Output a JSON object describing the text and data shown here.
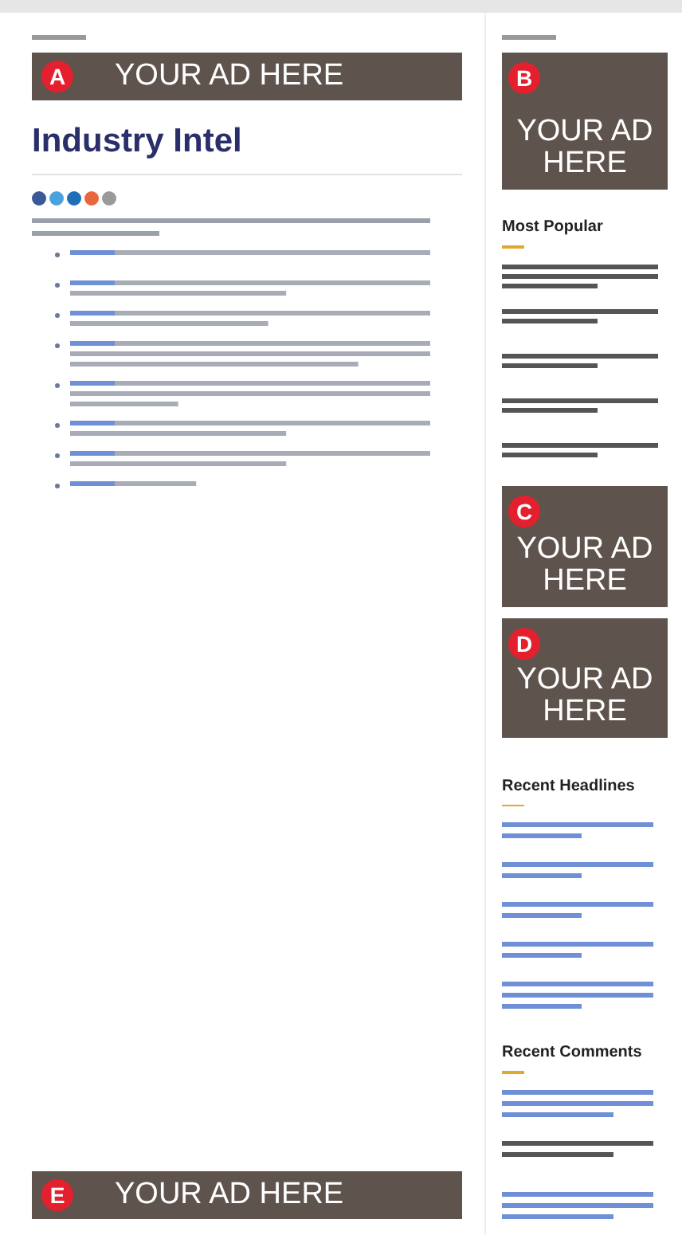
{
  "main": {
    "top_ad": {
      "badge": "A",
      "text": "YOUR AD HERE"
    },
    "title": "Industry Intel",
    "share_buttons": [
      {
        "color": "#3b5998"
      },
      {
        "color": "#4aa3df"
      },
      {
        "color": "#1d6fb8"
      },
      {
        "color": "#e8663d"
      },
      {
        "color": "#9a9a9a"
      }
    ],
    "bottom_ad": {
      "badge": "E",
      "text": "YOUR AD HERE"
    }
  },
  "sidebar": {
    "top_ad": {
      "badge": "B",
      "text": "YOUR AD HERE"
    },
    "most_popular": {
      "heading": "Most Popular"
    },
    "middle_ads": [
      {
        "badge": "C",
        "text": "YOUR AD HERE"
      },
      {
        "badge": "D",
        "text": "YOUR AD HERE"
      }
    ],
    "recent_headlines": {
      "heading": "Recent Headlines"
    },
    "recent_comments": {
      "heading": "Recent Comments"
    }
  }
}
